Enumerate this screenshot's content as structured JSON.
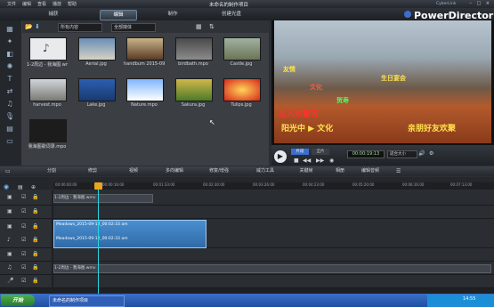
{
  "menu": [
    "文件",
    "编辑",
    "查看",
    "播放",
    "帮助"
  ],
  "window_title": "未命名的制作项目",
  "window_controls": "– □ ×",
  "mode_tabs": [
    "捕获",
    "编辑",
    "制作",
    "创建光盘"
  ],
  "active_mode_tab": "编辑",
  "brand": "PowerDirector",
  "cyberlink_text": "CyberLink",
  "library": {
    "filter_value": "所有内容",
    "scope_value": "全部媒体",
    "items": [
      {
        "label": "1-2周边 - 我海图.wmv"
      },
      {
        "label": "Aerial.jpg"
      },
      {
        "label": "handbum 2015-09..."
      },
      {
        "label": "birdbath.mpo"
      },
      {
        "label": "Castle.jpg"
      },
      {
        "label": "harvest.mpo"
      },
      {
        "label": "Lake.jpg"
      },
      {
        "label": "Nature.mpo"
      },
      {
        "label": "Sakura.jpg"
      },
      {
        "label": "Tulips.jpg"
      },
      {
        "label": "我海图歌词录.mpo"
      }
    ]
  },
  "preview": {
    "overlay_lines": [
      "友情",
      "文化",
      "生日宴会",
      "贺寿",
      "友人欢聚齐",
      "阳光中 ▶ 文化",
      "亲朋好友欢聚"
    ]
  },
  "playback": {
    "mode_clip": "片段",
    "mode_movie": "全片",
    "timecode": "00:00:19:13",
    "fit_label": "适合大小"
  },
  "timeline_tools": [
    "分割",
    "修剪",
    "视频",
    "多向编辑",
    "修复/增强",
    "威力工具",
    "关键帧",
    "相册",
    "编辑音频"
  ],
  "ruler_marks": [
    "00:00:00:00",
    "00:00:16:00",
    "00:01:33:00",
    "00:02:30:00",
    "00:03:26:00",
    "00:04:23:00",
    "00:05:20:00",
    "00:06:16:00",
    "00:07:13:00"
  ],
  "tracks": {
    "text_clip": "1-2周边 - 我海图.wmv",
    "video_clip_top": "Meadows_2015-09-12_00:02:33 am",
    "video_clip_bottom": "Meadows_2015-09-12_00:02:33 am",
    "audio_clip": "1-2周边 - 我海图.wmv"
  },
  "taskbar": {
    "start": "开始",
    "app": "未命名的制作项目",
    "clock": "14:55"
  }
}
